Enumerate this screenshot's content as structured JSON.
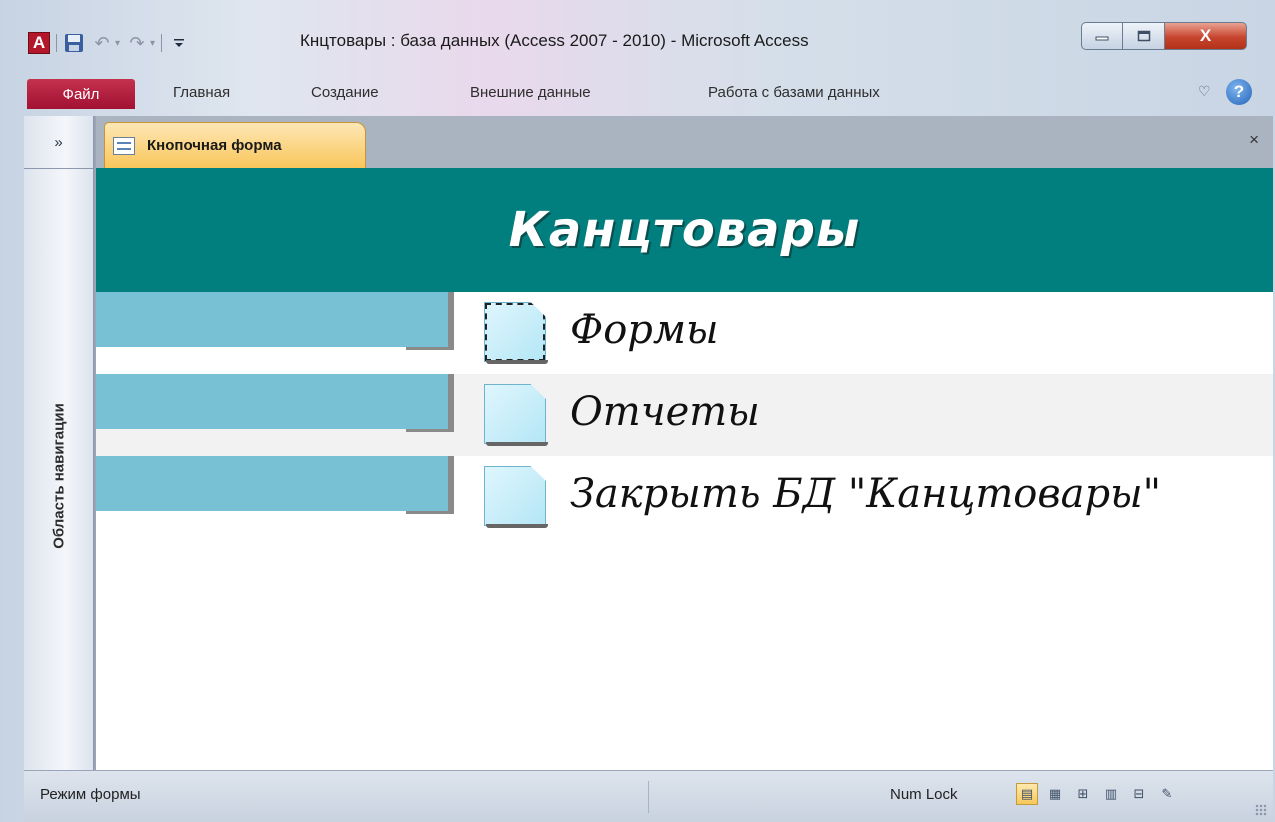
{
  "window": {
    "title": "Кнцтовары : база данных (Access 2007 - 2010)  -  Microsoft Access",
    "app_icon_letter": "A",
    "close_glyph": "X"
  },
  "ribbon": {
    "file_tab": "Файл",
    "tabs": [
      "Главная",
      "Создание",
      "Внешние данные",
      "Работа с базами данных"
    ],
    "help_glyph": "?"
  },
  "nav_pane": {
    "toggle": "»",
    "label": "Область навигации"
  },
  "document": {
    "tab_label": "Кнопочная форма",
    "close_glyph": "×"
  },
  "form": {
    "title": "Канцтовары",
    "items": [
      {
        "label": "Формы",
        "focused": true
      },
      {
        "label": "Отчеты",
        "focused": false
      },
      {
        "label": "Закрыть БД \"Канцтовары\"",
        "focused": false
      }
    ]
  },
  "status_bar": {
    "mode": "Режим формы",
    "numlock": "Num Lock",
    "view_buttons": [
      "form-view",
      "datasheet-view",
      "pivot-table-view",
      "pivot-chart-view",
      "layout-view",
      "design-view"
    ],
    "active_view": "form-view"
  },
  "colors": {
    "header_band": "#017e7e",
    "menu_bar": "#78c0d4",
    "file_tab": "#b01a3d",
    "doc_tab": "#f9c65b"
  }
}
